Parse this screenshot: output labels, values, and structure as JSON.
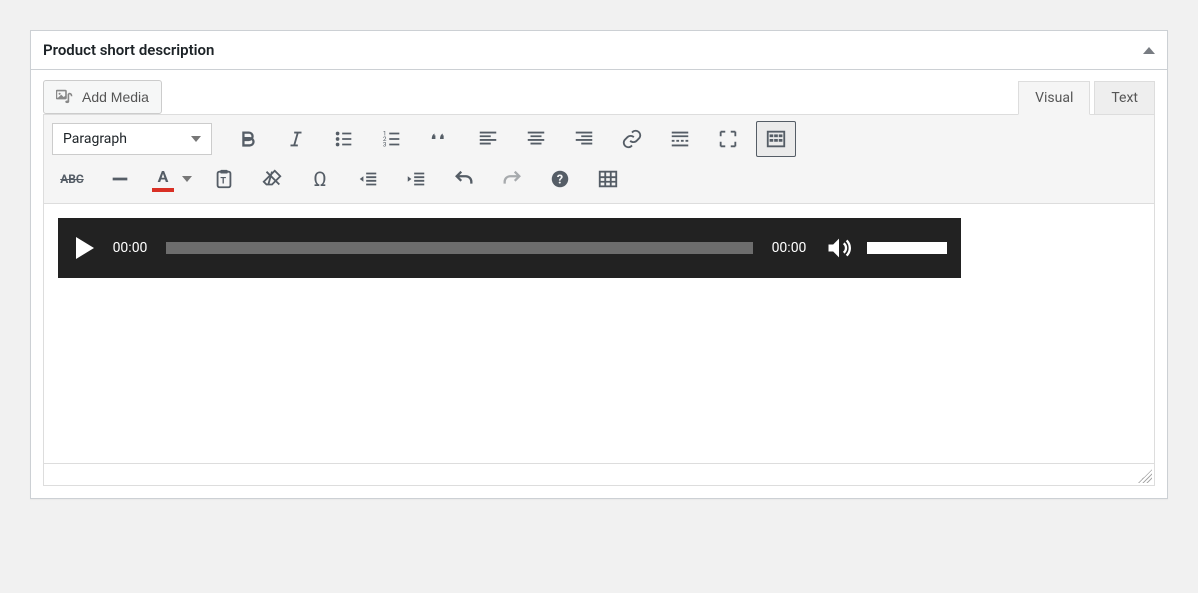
{
  "panel": {
    "title": "Product short description"
  },
  "buttons": {
    "add_media": "Add Media"
  },
  "tabs": {
    "visual": "Visual",
    "text": "Text"
  },
  "format_select": {
    "value": "Paragraph"
  },
  "toolbar": {
    "row1": [
      "bold",
      "italic",
      "bulleted-list",
      "numbered-list",
      "blockquote",
      "align-left",
      "align-center",
      "align-right",
      "insert-link",
      "insert-more",
      "fullscreen",
      "toolbar-toggle"
    ],
    "row2": [
      "strikethrough",
      "horizontal-rule",
      "text-color",
      "paste-as-text",
      "clear-formatting",
      "special-character",
      "outdent",
      "indent",
      "undo",
      "redo",
      "help",
      "table"
    ]
  },
  "audio": {
    "current_time": "00:00",
    "duration": "00:00"
  },
  "colors": {
    "text_color_swatch": "#d93025"
  }
}
